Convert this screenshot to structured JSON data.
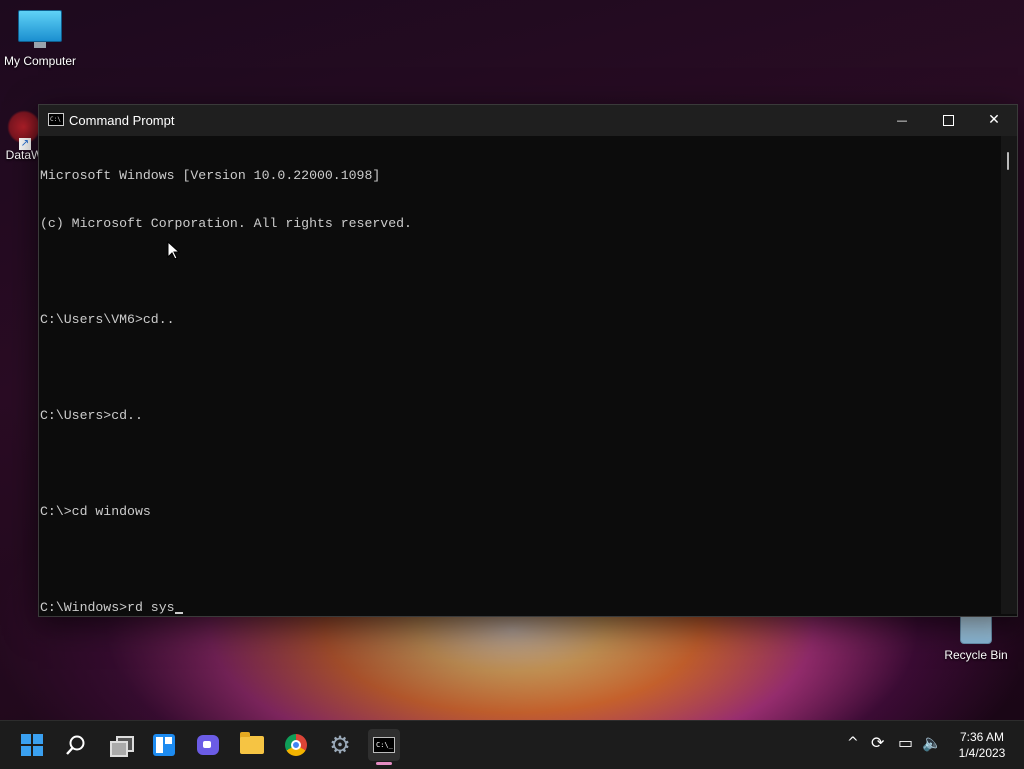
{
  "desktop": {
    "icons": [
      {
        "label": "My Computer",
        "icon": "monitor-icon"
      },
      {
        "label": "DataW",
        "icon": "datawrapper-shortcut-icon"
      },
      {
        "label": "Recycle Bin",
        "icon": "recycle-bin-icon"
      }
    ]
  },
  "cmd_window": {
    "title": "Command Prompt",
    "controls": {
      "minimize": "—",
      "close": "✕"
    },
    "console_lines": [
      "Microsoft Windows [Version 10.0.22000.1098]",
      "(c) Microsoft Corporation. All rights reserved.",
      "",
      "C:\\Users\\VM6>cd..",
      "",
      "C:\\Users>cd..",
      "",
      "C:\\>cd windows",
      "",
      "C:\\Windows>rd sys"
    ]
  },
  "taskbar": {
    "apps": [
      "start-icon",
      "search-icon",
      "task-view-icon",
      "widgets-icon",
      "chat-icon",
      "file-explorer-icon",
      "chrome-icon",
      "settings-icon",
      "command-prompt-icon"
    ],
    "active_app": "command-prompt-icon",
    "tray": {
      "chevron": "^",
      "sync": "⟳",
      "network": "▭",
      "volume": "🔈"
    },
    "clock": {
      "time": "7:36 AM",
      "date": "1/4/2023"
    }
  },
  "colors": {
    "console_bg": "#0c0c0c",
    "console_text": "#cccccc",
    "titlebar": "#1f1f1f",
    "taskbar": "#1c1c1c",
    "accent": "#3aa0f0"
  }
}
